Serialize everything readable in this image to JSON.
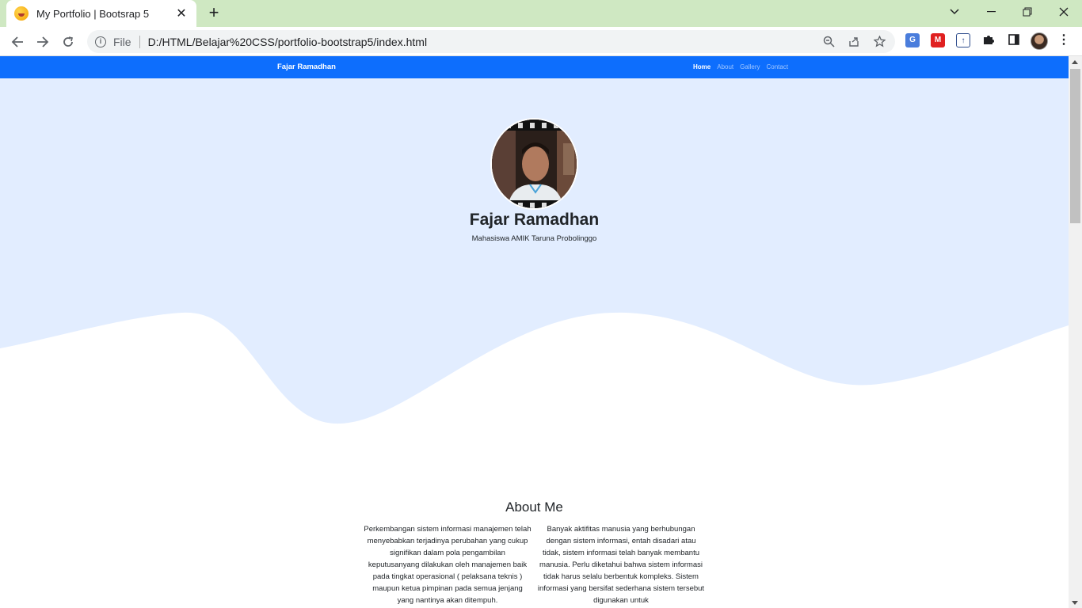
{
  "browser": {
    "tab_title": "My Portfolio | Bootsrap 5",
    "tab_close": "✕",
    "new_tab": "+",
    "file_label": "File",
    "url": "D:/HTML/Belajar%20CSS/portfolio-bootstrap5/index.html",
    "window_controls": {
      "dropdown": "⌄",
      "minimize": "—",
      "restore": "❐",
      "close": "✕"
    }
  },
  "site": {
    "brand": "Fajar Ramadhan",
    "nav": [
      {
        "label": "Home",
        "active": true
      },
      {
        "label": "About",
        "active": false
      },
      {
        "label": "Gallery",
        "active": false
      },
      {
        "label": "Contact",
        "active": false
      }
    ],
    "hero": {
      "name": "Fajar Ramadhan",
      "subtitle": "Mahasiswa AMIK Taruna Probolinggo"
    },
    "about": {
      "title": "About Me",
      "col1": "Perkembangan sistem informasi manajemen telah menyebabkan terjadinya perubahan yang cukup signifikan dalam pola pengambilan keputusanyang dilakukan oleh manajemen baik pada tingkat operasional ( pelaksana teknis ) maupun ketua pimpinan pada semua jenjang yang nantinya akan ditempuh.",
      "col2": "Banyak aktifitas manusia yang berhubungan dengan sistem informasi, entah disadari atau tidak, sistem informasi telah banyak membantu manusia. Perlu diketahui bahwa sistem informasi tidak harus selalu berbentuk kompleks. Sistem informasi yang bersifat sederhana sistem tersebut digunakan untuk"
    }
  },
  "colors": {
    "navbar": "#0d6efd",
    "hero_bg": "#e2edff",
    "titlebar": "#cfe8c2"
  }
}
